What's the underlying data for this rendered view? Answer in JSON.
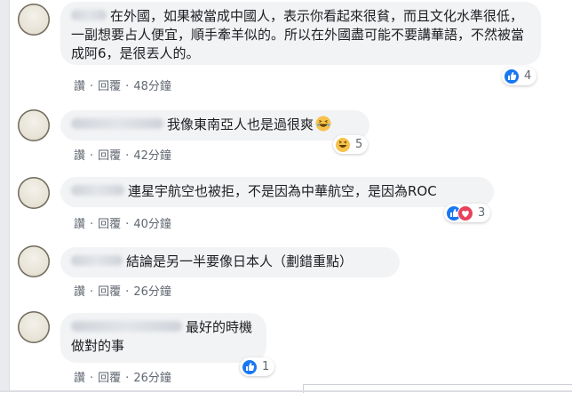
{
  "comments": [
    {
      "text": "在外國，如果被當成中國人，表示你看起來很貧，而且文化水準很低，一副想要占人便宜，順手牽羊似的。所以在外國盡可能不要講華語，不然被當成阿6，是很丟人的。",
      "like_label": "讚",
      "reply_label": "回覆",
      "time": "48分鐘",
      "reactions": [
        "like-icon"
      ],
      "reaction_count": "4"
    },
    {
      "text": "我像東南亞人也是過很爽",
      "trailing_emoji": "laughing-emoji",
      "like_label": "讚",
      "reply_label": "回覆",
      "time": "42分鐘",
      "reactions": [
        "haha-icon"
      ],
      "reaction_count": "5"
    },
    {
      "text": "連星宇航空也被拒，不是因為中華航空，是因為ROC",
      "like_label": "讚",
      "reply_label": "回覆",
      "time": "40分鐘",
      "reactions": [
        "like-icon",
        "love-icon"
      ],
      "reaction_count": "3"
    },
    {
      "text": "結論是另一半要像日本人（劃錯重點）",
      "like_label": "讚",
      "reply_label": "回覆",
      "time": "26分鐘",
      "reactions": [],
      "reaction_count": ""
    },
    {
      "text": "最好的時機\n做對的事",
      "like_label": "讚",
      "reply_label": "回覆",
      "time": "26分鐘",
      "reactions": [
        "like-icon"
      ],
      "reaction_count": "1"
    }
  ],
  "colors": {
    "bubble": "#f2f3f5",
    "meta_text": "#606770",
    "like_blue": "#1877f2",
    "love_red": "#e8415b",
    "haha_yellow": "#f7c14c"
  }
}
